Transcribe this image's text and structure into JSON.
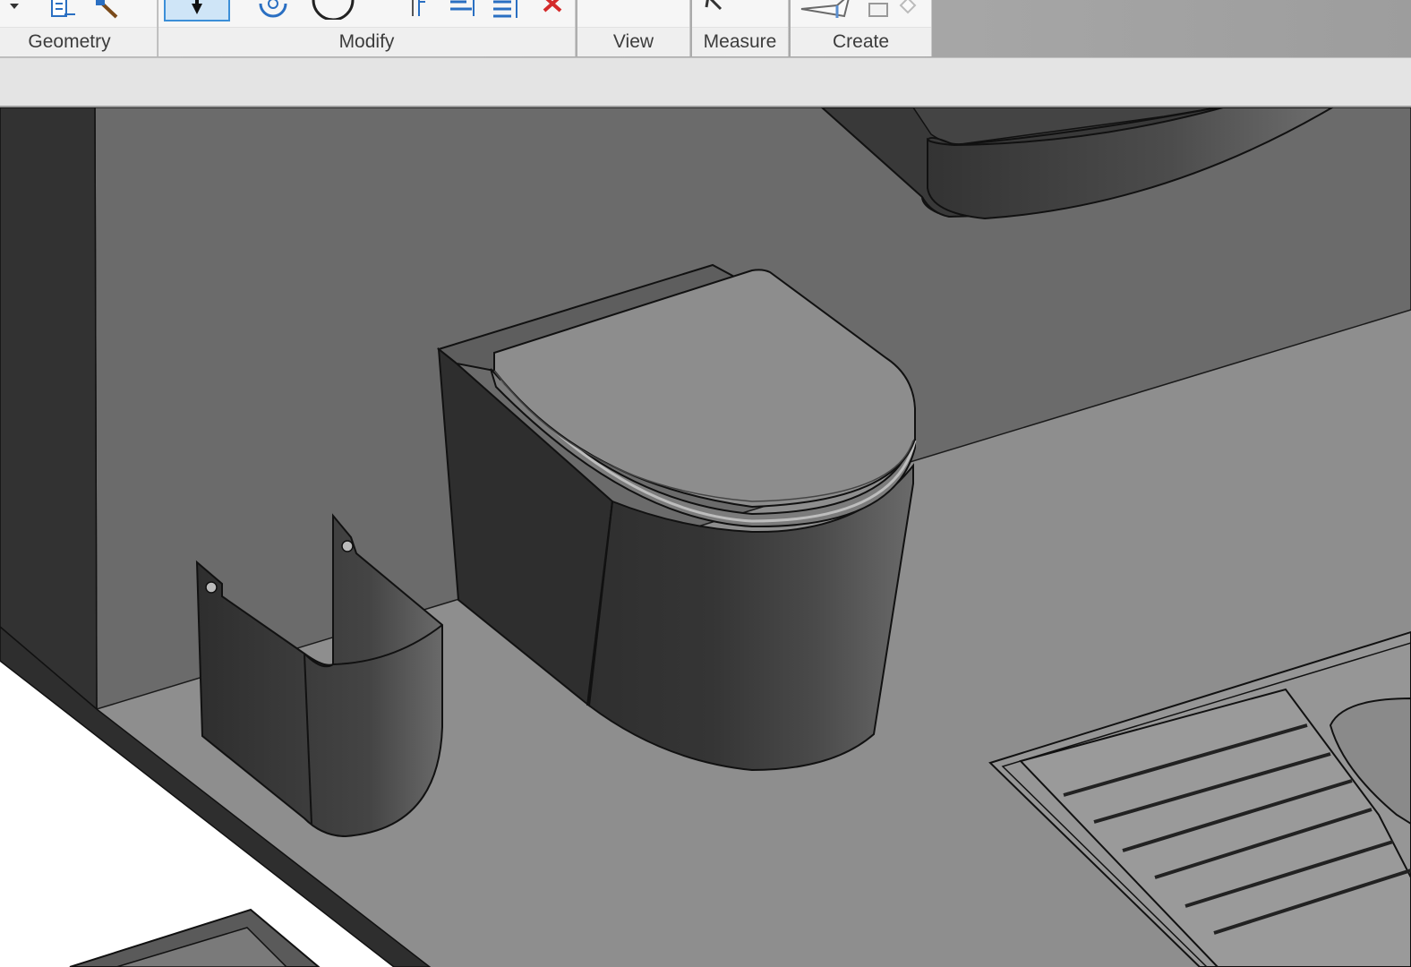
{
  "ribbon": {
    "panels": {
      "geometry": {
        "label": "Geometry"
      },
      "modify": {
        "label": "Modify"
      },
      "view": {
        "label": "View"
      },
      "measure": {
        "label": "Measure"
      },
      "create": {
        "label": "Create"
      }
    },
    "icons": {
      "geometry": [
        "dropdown-arrow-icon",
        "join-geometry-icon",
        "paint-hammer-icon"
      ],
      "modify": [
        "move-down-icon",
        "rotate-icon",
        "circle-icon",
        "align-icon",
        "split-icon",
        "trim-icon",
        "delete-icon"
      ],
      "measure": [
        "measure-icon"
      ],
      "create": [
        "create-component-icon",
        "create-small-icon",
        "create-diamond-icon"
      ]
    },
    "colors": {
      "selected_tool": "#cfe5f7",
      "selected_border": "#3c8fd8",
      "delete_icon": "#d42a2a",
      "tool_icon_blue": "#2a6fc2"
    }
  },
  "options_bar": {},
  "viewport": {
    "view_type": "3D shaded view",
    "objects": [
      "wall-hung-toilet",
      "siphon-cover",
      "sink-with-drainboard",
      "washbasin",
      "wall",
      "floor"
    ],
    "colors": {
      "floor": "#8e8e8e",
      "wall": "#6b6b6b",
      "dark_surface": "#313131",
      "edge_line": "#111111"
    }
  }
}
